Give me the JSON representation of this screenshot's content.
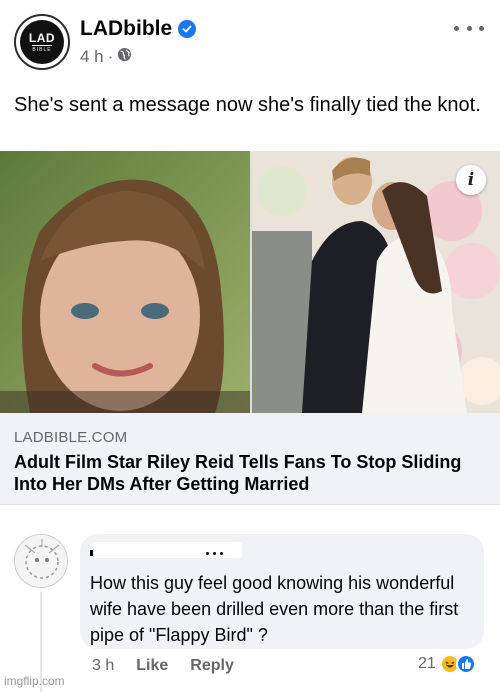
{
  "post": {
    "page_name": "LADbible",
    "avatar_line1": "LAD",
    "avatar_line2": "BIBLE",
    "timestamp": "4 h",
    "separator": "·",
    "text": "She's sent a message now she's finally tied the knot.",
    "info_glyph": "i"
  },
  "link": {
    "domain": "LADBIBLE.COM",
    "title": "Adult Film Star Riley Reid Tells Fans To Stop Sliding Into Her DMs After Getting Married"
  },
  "comment": {
    "text": "How this guy feel good knowing his wonderful wife have been drilled even more than the first pipe of \"Flappy Bird\" ?",
    "time": "3 h",
    "like_label": "Like",
    "reply_label": "Reply",
    "reaction_count": "21"
  },
  "watermark": "imgflip.com",
  "colors": {
    "brand_blue": "#1877f2",
    "meta_gray": "#65676b",
    "bubble_bg": "#f0f2f5",
    "haha_yellow": "#f7b928"
  },
  "icons": [
    "verified-badge-icon",
    "globe-icon",
    "more-options-icon",
    "info-icon",
    "haha-reaction-icon",
    "like-reaction-icon"
  ]
}
